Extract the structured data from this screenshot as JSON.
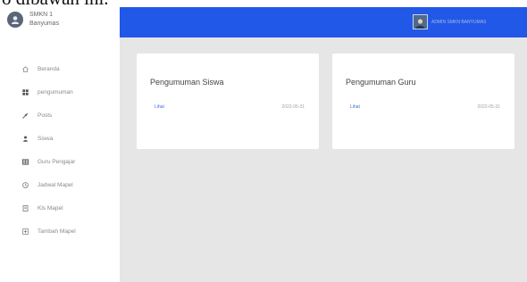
{
  "caption": "o dibawah ini.",
  "brand": {
    "line1": "SMKN 1",
    "line2": "Banyumas"
  },
  "sidebar": {
    "items": [
      {
        "label": "Beranda",
        "icon": "home-icon"
      },
      {
        "label": "pengumuman",
        "icon": "grid-icon"
      },
      {
        "label": "Posts",
        "icon": "pin-icon"
      },
      {
        "label": "Siswa",
        "icon": "user-icon"
      },
      {
        "label": "Guru Pengajar",
        "icon": "table-icon"
      },
      {
        "label": "Jadwal Mapel",
        "icon": "clock-icon"
      },
      {
        "label": "Kls Mapel",
        "icon": "book-icon"
      },
      {
        "label": "Tambah Mapel",
        "icon": "plus-icon"
      }
    ]
  },
  "header": {
    "user_name": "ADMIN SMKN BANYUMAS"
  },
  "cards": [
    {
      "title": "Pengumuman Siswa",
      "link": "Lihat",
      "date": "2022-05-31"
    },
    {
      "title": "Pengumuman Guru",
      "link": "Lihat",
      "date": "2022-05-31"
    }
  ],
  "colors": {
    "topbar": "#2158e8",
    "content_bg": "#e6e6e6",
    "link": "#3a6fd8"
  }
}
